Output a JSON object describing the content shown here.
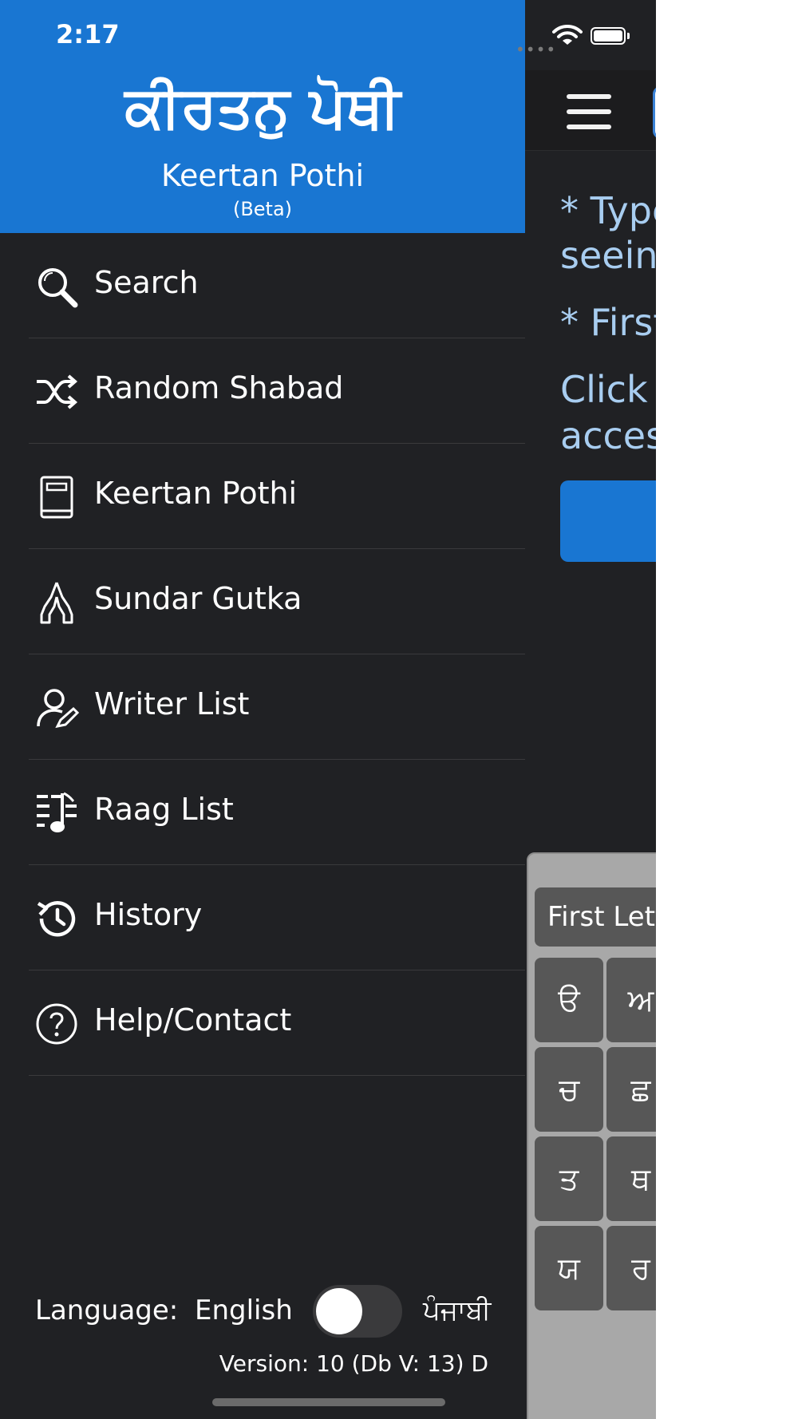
{
  "status_bar": {
    "time": "2:17",
    "signal_dots": "••••"
  },
  "drawer": {
    "header": {
      "title_punjabi": "ਕੀਰਤਨੁ ਪੋਥੀ",
      "title_english": "Keertan Pothi",
      "badge": "(Beta)"
    },
    "menu": [
      {
        "label": "Search",
        "icon": "search-icon"
      },
      {
        "label": "Random Shabad",
        "icon": "shuffle-icon"
      },
      {
        "label": "Keertan Pothi",
        "icon": "book-icon"
      },
      {
        "label": "Sundar Gutka",
        "icon": "praying-hands-icon"
      },
      {
        "label": "Writer List",
        "icon": "writer-icon"
      },
      {
        "label": "Raag List",
        "icon": "music-list-icon"
      },
      {
        "label": "History",
        "icon": "history-icon"
      },
      {
        "label": "Help/Contact",
        "icon": "help-icon"
      }
    ],
    "footer": {
      "language_label": "Language:",
      "language_option_left": "English",
      "language_option_right": "ਪੰਜਾਬੀ",
      "toggle_on": false,
      "version": "Version: 10 (Db V: 13) D"
    }
  },
  "background": {
    "text_line_1": "* Type",
    "text_line_2": "seeing",
    "text_line_3": "* First",
    "text_line_4": "Click o",
    "text_line_5": "access",
    "keyboard": {
      "label": "First Lett",
      "keys": [
        "ੳ",
        "ਅ",
        "ਚ",
        "ਛ",
        "ਤ",
        "ਥ",
        "ਯ",
        "ਰ"
      ]
    }
  },
  "colors": {
    "header_blue": "#1976d2",
    "drawer_bg": "#202124",
    "text_white": "#ffffff",
    "link_blue": "#a8cdf0"
  }
}
